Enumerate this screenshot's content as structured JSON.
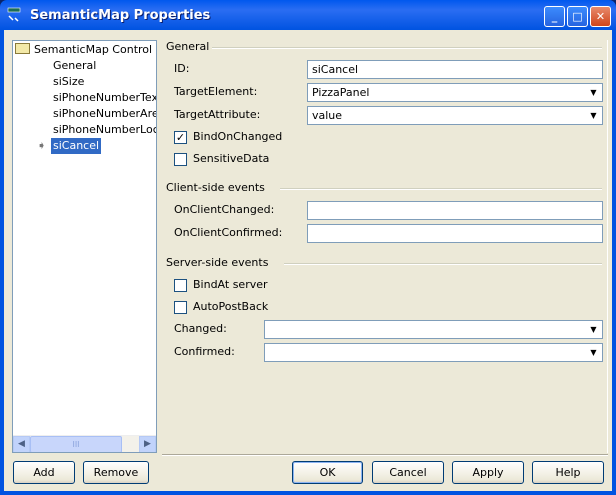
{
  "window": {
    "title": "SemanticMap Properties",
    "minimize": "_",
    "maximize": "□",
    "close": "✕"
  },
  "tree": {
    "root": "SemanticMap Control",
    "items": [
      "General",
      "siSize",
      "siPhoneNumberText",
      "siPhoneNumberAreaC",
      "siPhoneNumberLocalI",
      "siCancel"
    ],
    "selected": "siCancel",
    "scroll_thumb": "III"
  },
  "general": {
    "header": "General",
    "id_label": "ID:",
    "id_value": "siCancel",
    "target_element_label": "TargetElement:",
    "target_element_value": "PizzaPanel",
    "target_attribute_label": "TargetAttribute:",
    "target_attribute_value": "value",
    "bind_on_changed_label": "BindOnChanged",
    "bind_on_changed": true,
    "sensitive_data_label": "SensitiveData",
    "sensitive_data": false
  },
  "client_events": {
    "header": "Client-side events",
    "on_client_changed_label": "OnClientChanged:",
    "on_client_changed_value": "",
    "on_client_confirmed_label": "OnClientConfirmed:",
    "on_client_confirmed_value": ""
  },
  "server_events": {
    "header": "Server-side events",
    "bind_at_server_label": "BindAt server",
    "bind_at_server": false,
    "auto_post_back_label": "AutoPostBack",
    "auto_post_back": false,
    "changed_label": "Changed:",
    "changed_value": "",
    "confirmed_label": "Confirmed:",
    "confirmed_value": ""
  },
  "buttons": {
    "add": "Add",
    "remove": "Remove",
    "ok": "OK",
    "cancel": "Cancel",
    "apply": "Apply",
    "help": "Help"
  }
}
